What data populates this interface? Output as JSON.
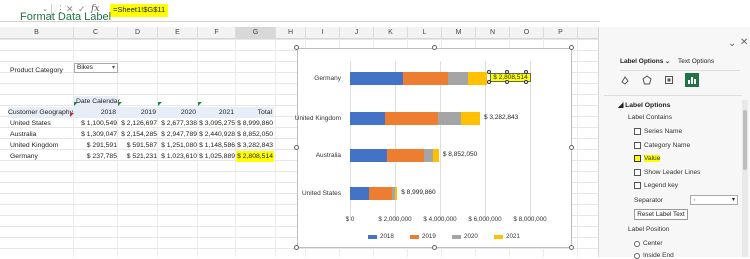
{
  "formula_bar": {
    "formula": "=Sheet1!$G$11",
    "fx": "fx",
    "cancel": "✕",
    "confirm": "✓"
  },
  "columns": [
    "B",
    "C",
    "D",
    "E",
    "F",
    "G",
    "H",
    "I",
    "J",
    "K",
    "L",
    "M",
    "N",
    "O",
    "P"
  ],
  "sheet": {
    "product_category_label": "Product Category",
    "product_category_value": "Bikes",
    "date_calendar_label": "Date Calendar",
    "customer_geography_label": "Customer Geography",
    "headers": [
      "2018",
      "2019",
      "2020",
      "2021",
      "Total"
    ],
    "rows": [
      {
        "name": "United States",
        "values": [
          "$ 1,100,549",
          "$ 2,126,697",
          "$ 2,677,338",
          "$ 3,095,275",
          "$ 8,999,860"
        ]
      },
      {
        "name": "Australia",
        "values": [
          "$ 1,309,047",
          "$ 2,154,285",
          "$ 2,947,789",
          "$ 2,440,928",
          "$ 8,852,050"
        ]
      },
      {
        "name": "United Kingdom",
        "values": [
          "$ 291,591",
          "$ 591,587",
          "$ 1,251,080",
          "$ 1,148,586",
          "$ 3,282,843"
        ]
      },
      {
        "name": "Germany",
        "values": [
          "$ 237,785",
          "$ 521,231",
          "$ 1,023,610",
          "$ 1,025,889",
          "$ 2,808,514"
        ]
      }
    ]
  },
  "chart_data": {
    "type": "bar",
    "orientation": "horizontal",
    "stacked": true,
    "categories": [
      "Germany",
      "United Kingdom",
      "Australia",
      "United States"
    ],
    "series": [
      {
        "name": "2018",
        "color": "#4472c4",
        "values": [
          2375000,
          1575000,
          1650000,
          850000
        ]
      },
      {
        "name": "2019",
        "color": "#ed7d31",
        "values": [
          2000000,
          2350000,
          1650000,
          1000000
        ]
      },
      {
        "name": "2020",
        "color": "#a5a5a5",
        "values": [
          850000,
          1000000,
          400000,
          150000
        ]
      },
      {
        "name": "2021",
        "color": "#ffc000",
        "values": [
          875000,
          850000,
          250000,
          100000
        ]
      }
    ],
    "totals": [
      "$ 2,808,514",
      "$ 3,282,843",
      "$ 8,852,050",
      "$ 8,999,860"
    ],
    "x_ticks": [
      "$ 0",
      "$ 2,000,000",
      "$ 4,000,000",
      "$ 6,000,000",
      "$ 8,000,000"
    ],
    "xlim": [
      0,
      8000000
    ]
  },
  "pane": {
    "title": "Format Data Label",
    "tab_label_options": "Label Options",
    "tab_text_options": "Text Options",
    "section_label_options": "Label Options",
    "label_contains": "Label Contains",
    "checkboxes": [
      "Series Name",
      "Category Name",
      "Value",
      "Show Leader Lines",
      "Legend key"
    ],
    "separator_label": "Separator",
    "separator_value": ",",
    "reset_button": "Reset Label Text",
    "label_position": "Label Position",
    "radios": [
      "Center",
      "Inside End"
    ]
  },
  "colors": {
    "accent": "#217346",
    "highlight": "#ffff00"
  }
}
